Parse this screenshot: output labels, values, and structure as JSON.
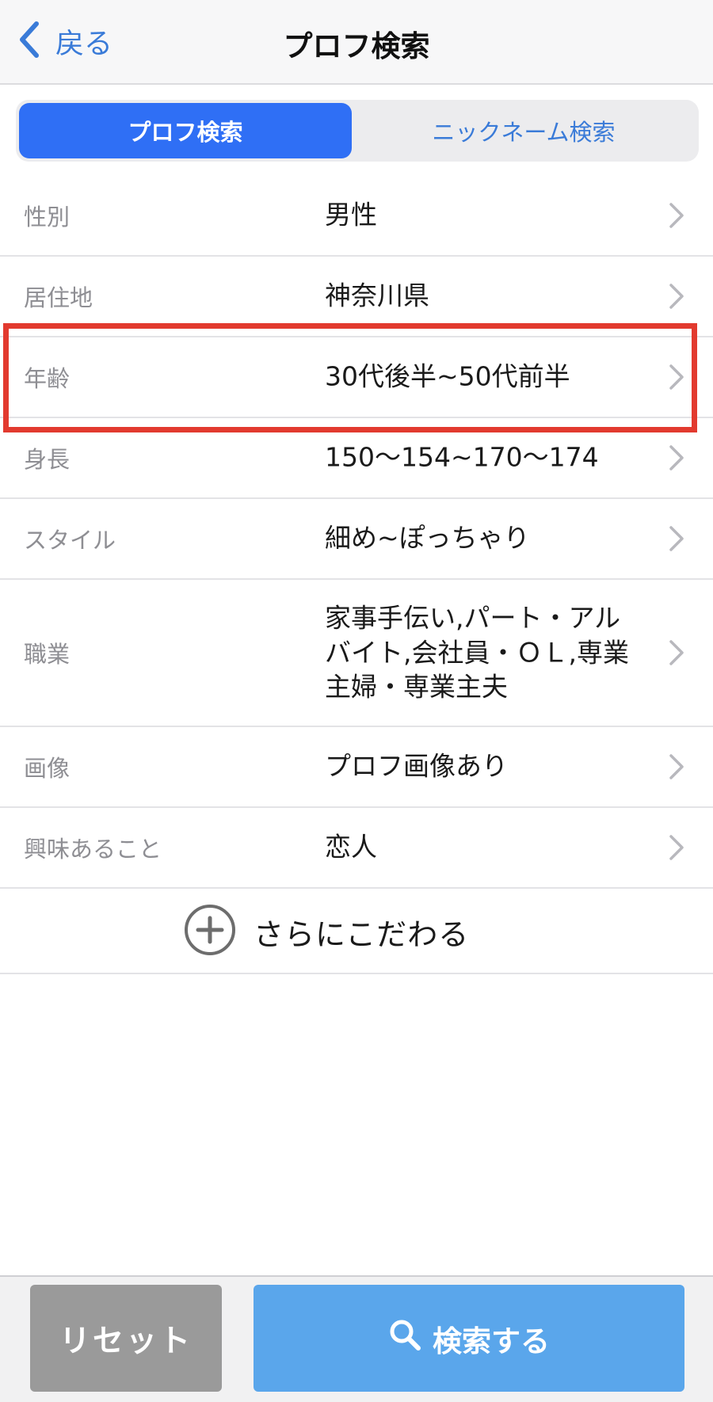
{
  "nav": {
    "back_label": "戻る",
    "title": "プロフ検索"
  },
  "segments": {
    "active": "プロフ検索",
    "inactive": "ニックネーム検索"
  },
  "rows": [
    {
      "label": "性別",
      "value": "男性"
    },
    {
      "label": "居住地",
      "value": "神奈川県"
    },
    {
      "label": "年齢",
      "value": "30代後半~50代前半"
    },
    {
      "label": "身長",
      "value": "150〜154~170〜174"
    },
    {
      "label": "スタイル",
      "value": "細め~ぽっちゃり"
    },
    {
      "label": "職業",
      "value_lines": [
        "家事手伝い,パート・アル",
        "バイト,会社員・ＯＬ,専業",
        "主婦・専業主夫"
      ]
    },
    {
      "label": "画像",
      "value": "プロフ画像あり"
    },
    {
      "label": "興味あること",
      "value": "恋人"
    }
  ],
  "more": {
    "label": "さらにこだわる"
  },
  "footer": {
    "reset_label": "リセット",
    "search_label": "検索する"
  },
  "colors": {
    "accent": "#2f6ff5",
    "link": "#3a7bd8",
    "highlight": "#e23a2f",
    "search_button": "#5aa6eb",
    "reset_button": "#9a9a9a"
  }
}
